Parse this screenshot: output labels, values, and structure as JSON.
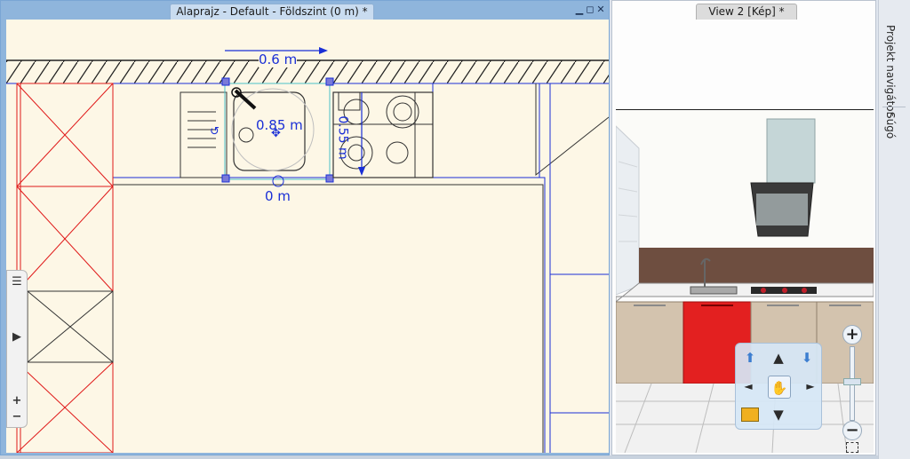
{
  "plan_window": {
    "title": "Alaprajz - Default - Földszint (0 m) *",
    "controls": [
      "▁",
      "◻",
      "✕"
    ],
    "dimensions": {
      "width_label": "0.6 m",
      "depth_label": "0.85 m",
      "offset_label": "0 m",
      "vertical_label": "0.55 m"
    }
  },
  "side_toolbar": {
    "list_icon": "☰",
    "expand_icon": "▶",
    "zoom_in": "+",
    "zoom_out": "−"
  },
  "view_window": {
    "title": "View 2 [Kép] *"
  },
  "nav_pad": {
    "up": "▲",
    "down": "▼",
    "left": "◄",
    "right": "►",
    "tilt_up": "⬆",
    "tilt_down": "⬇",
    "pan": "✋"
  },
  "zoom": {
    "plus": "+",
    "minus": "−"
  },
  "dock": {
    "project_navigator": "Projekt navigátor",
    "help": "Súgó"
  },
  "colors": {
    "plan_background": "#fdf7e6",
    "accent_blue": "#1a2fd6",
    "red_cabinet": "#e01818",
    "window_border": "#7aa6d4"
  }
}
